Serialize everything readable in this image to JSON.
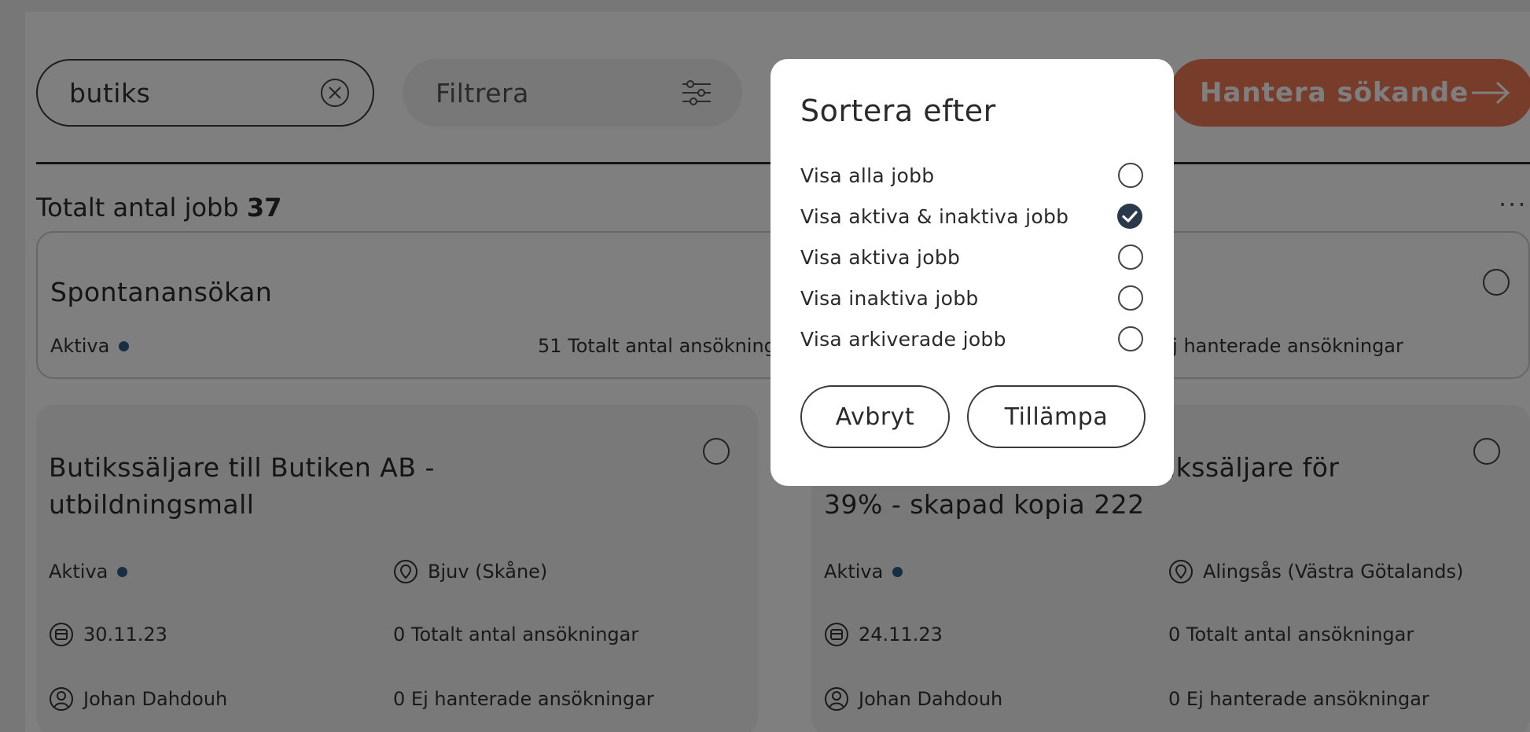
{
  "toolbar": {
    "search_value": "butiks",
    "filter_label": "Filtrera",
    "manage_label": "Hantera sökande"
  },
  "summary": {
    "total_label": "Totalt antal jobb",
    "total_count": "37"
  },
  "cards": [
    {
      "title": "Spontanansökan",
      "status": "Aktiva",
      "applications": "51 Totalt antal ansökningar",
      "unhandled": "Ej hanterade ansökningar"
    },
    {
      "title_line1": "Butikssäljare till Butiken AB -",
      "title_line2": "utbildningsmall",
      "status": "Aktiva",
      "location": "Bjuv (Skåne)",
      "date": "30.11.23",
      "applications": "0 Totalt antal ansökningar",
      "owner": "Johan Dahdouh",
      "unhandled": "0 Ej hanterade ansökningar"
    },
    {
      "title_line1": "ikssäljare för",
      "title_line2": "39% - skapad kopia 222",
      "status": "Aktiva",
      "location": "Alingsås (Västra Götalands)",
      "date": "24.11.23",
      "applications": "0 Totalt antal ansökningar",
      "owner": "Johan Dahdouh",
      "unhandled": "0 Ej hanterade ansökningar"
    }
  ],
  "modal": {
    "title": "Sortera efter",
    "options": [
      {
        "label": "Visa alla jobb",
        "selected": false
      },
      {
        "label": "Visa aktiva & inaktiva jobb",
        "selected": true
      },
      {
        "label": "Visa aktiva jobb",
        "selected": false
      },
      {
        "label": "Visa inaktiva jobb",
        "selected": false
      },
      {
        "label": "Visa arkiverade jobb",
        "selected": false
      }
    ],
    "cancel_label": "Avbryt",
    "apply_label": "Tillämpa"
  },
  "colors": {
    "accent": "#f07a55",
    "status_dot": "#2e5f8a",
    "overlay": "rgba(0,0,0,0.5)"
  },
  "icons": [
    "clear-icon",
    "sliders-icon",
    "arrow-right-icon",
    "more-icon",
    "location-icon",
    "calendar-icon",
    "user-icon",
    "check-circle-icon"
  ]
}
